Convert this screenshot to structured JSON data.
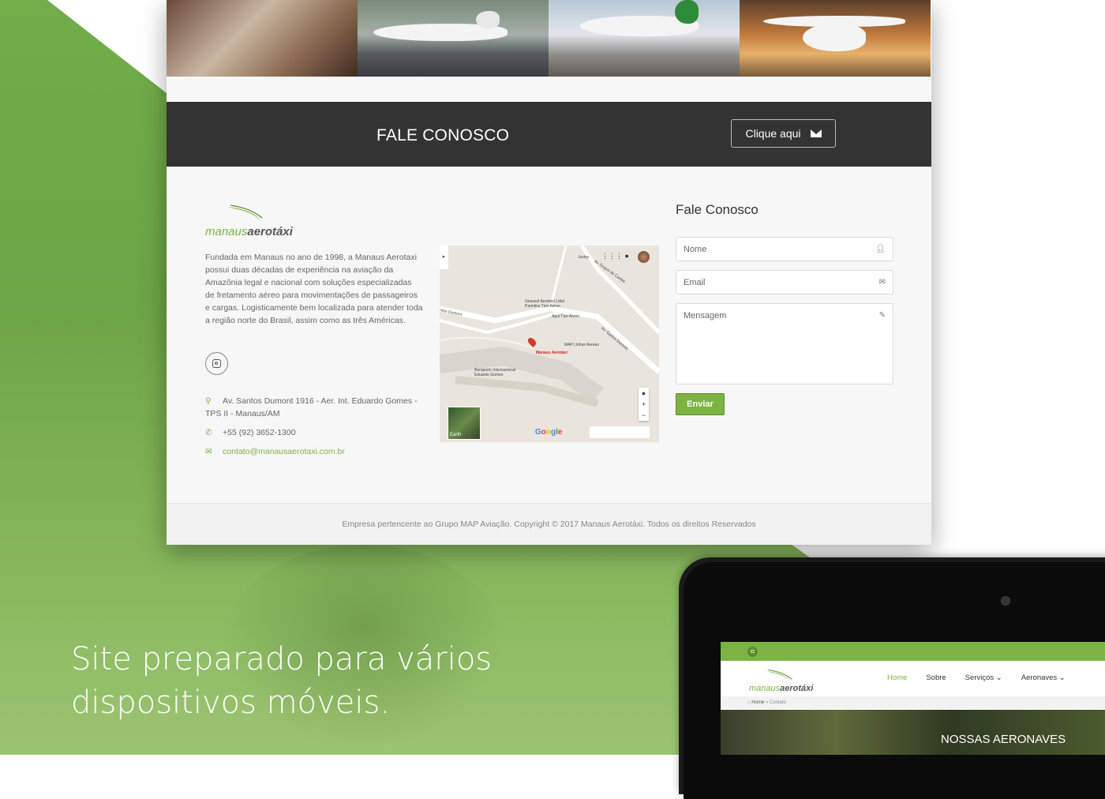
{
  "cta": {
    "title": "FALE CONOSCO",
    "button": "Clique aqui",
    "button_icon": "envelope-icon"
  },
  "brand": {
    "name_part1": "manaus",
    "name_part2": "aerotáxi",
    "color": "#7cb342"
  },
  "about": "Fundada em Manaus no ano de 1998, a Manaus Aerotaxi possui duas décadas de experiência na aviação da Amazônia legal e nacional com soluções especializadas de fretamento aéreo para movimentações de passageiros e cargas. Logisticamente bem localizada para atender toda a região norte do Brasil, assim como as três Américas.",
  "contact": {
    "address": "Av. Santos Dumont 1916 - Aer. Int. Eduardo Gomes - TPS II - Manaus/AM",
    "phone": "+55 (92) 3652-1300",
    "email": "contato@manausaerotaxi.com.br"
  },
  "map": {
    "labels": {
      "jusley": "Jusley",
      "duque": "Av. Duque de Caxias",
      "girassol": "Girassol Aerotáxi Ltda/",
      "parintins": "Parintins Táxi Aéreo",
      "apui": "Apui Táxi Aéreo",
      "map_linhas": "MAP Linhas Aereas",
      "manaus": "Manaus Aerotáxi",
      "santos_dumont": "Av. Santos Dumont",
      "santos_dumont_left": "ntos Dumont",
      "aeroporto": "Aeroporto Internacional",
      "eduardo": "Eduardo Gomes"
    },
    "earth_label": "Earth",
    "google": "Google"
  },
  "form": {
    "title": "Fale Conosco",
    "name_placeholder": "Nome",
    "email_placeholder": "Email",
    "message_placeholder": "Mensagem",
    "submit": "Enviar"
  },
  "footer": "Empresa pertencente ao Grupo MAP Aviação. Copyright © 2017 Manaus Aerotáxi. Todos os direitos Reservados",
  "headline": {
    "line1": "Site preparado para vários",
    "line2": "dispositivos móveis."
  },
  "tablet": {
    "nav": [
      "Home",
      "Sobre",
      "Serviços",
      "Aeronaves"
    ],
    "breadcrumb_home": "Home",
    "breadcrumb_current": "Contato",
    "hero_title": "NOSSAS AERONAVES"
  }
}
